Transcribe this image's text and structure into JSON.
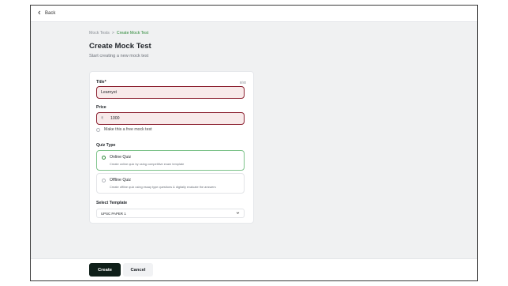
{
  "topbar": {
    "back_label": "Back"
  },
  "breadcrumb": {
    "parent": "Mock Tests",
    "separator": ">",
    "current": "Create Mock Test"
  },
  "header": {
    "title": "Create Mock Test",
    "subtitle": "Start creating a new mock test"
  },
  "form": {
    "title_label": "Title*",
    "title_counter": "8/80",
    "title_value": "Learnyst",
    "price_label": "Price",
    "price_currency": "₹",
    "price_value": "1000",
    "free_label": "Make this a free mock test",
    "quiz_type_label": "Quiz Type",
    "quiz_options": [
      {
        "title": "Online Quiz",
        "description": "Create online quiz by using competitive exam template",
        "selected": true
      },
      {
        "title": "Offline Quiz",
        "description": "Create offline quiz using essay type questions & digitally evaluate the answers",
        "selected": false
      }
    ],
    "template_label": "Select Template",
    "template_value": "UPSC PAPER 1"
  },
  "footer": {
    "create_label": "Create",
    "cancel_label": "Cancel"
  },
  "colors": {
    "accent_green": "#2f8a3a",
    "error_border": "#8b1f2f",
    "primary_button": "#0f1f19"
  }
}
